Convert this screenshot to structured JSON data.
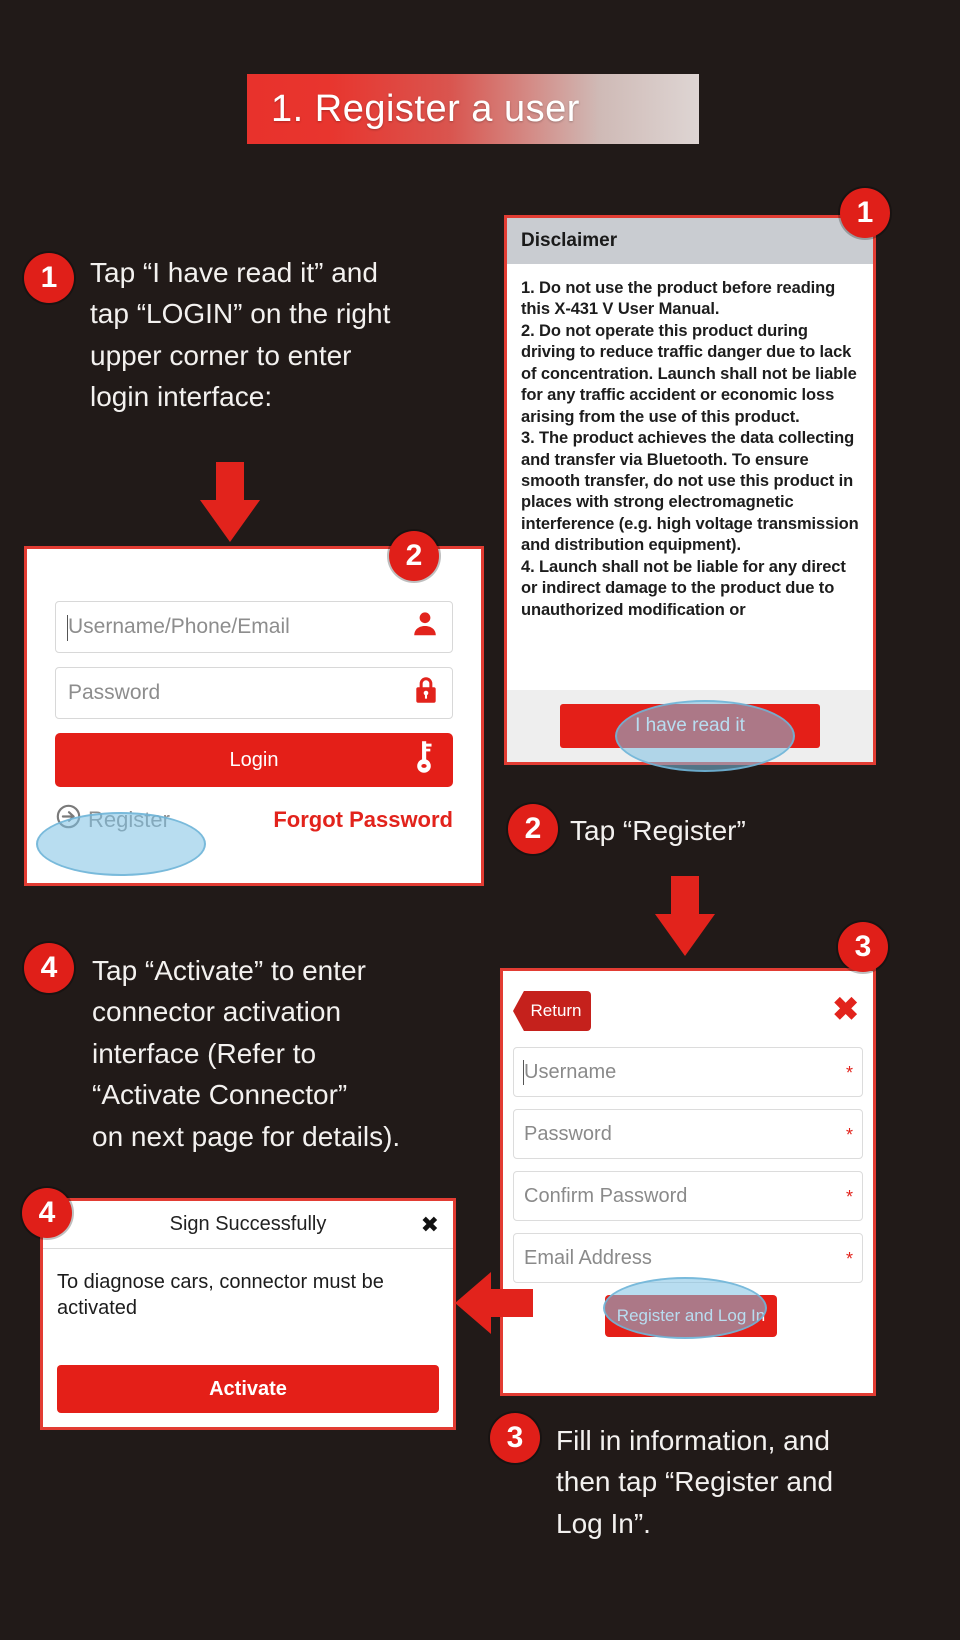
{
  "title": "1. Register a user",
  "steps": {
    "s1": {
      "num": "1",
      "text": "Tap “I have read it” and\ntap “LOGIN” on the right\nupper corner to enter\nlogin interface:"
    },
    "s2": {
      "num": "2",
      "text": "Tap “Register”"
    },
    "s3": {
      "num": "3",
      "text": "Fill in information, and\nthen tap “Register and\nLog In”."
    },
    "s4": {
      "num": "4",
      "text": "Tap “Activate” to enter\nconnector activation\ninterface (Refer to\n“Activate Connector”\non next page for details)."
    }
  },
  "markers": {
    "m1": "1",
    "m2": "2",
    "m3": "3",
    "m4": "4"
  },
  "disclaimer": {
    "title": "Disclaimer",
    "body": "1. Do not use the product before reading this X-431 V User Manual.\n 2. Do not operate this product during driving to reduce traffic danger due to lack of concentration. Launch shall not be liable for any traffic accident or economic loss arising from the use of this product.\n 3. The product achieves the data collecting and transfer via Bluetooth. To ensure smooth transfer, do not use this product in places with strong electromagnetic interference (e.g. high voltage transmission and distribution equipment).\n 4. Launch shall not be liable for any direct or indirect damage to the product due to unauthorized modification or",
    "accept_label": "I have read it"
  },
  "login": {
    "username_placeholder": "Username/Phone/Email",
    "password_placeholder": "Password",
    "login_label": "Login",
    "register_label": "Register",
    "forgot_label": "Forgot Password",
    "user_icon": "person-icon",
    "lock_icon": "lock-icon",
    "key_icon": "key-icon",
    "register_icon": "arrow-circle-right-icon"
  },
  "register": {
    "return_label": "Return",
    "close_icon": "close-x-icon",
    "fields": [
      {
        "placeholder": "Username",
        "required": "*"
      },
      {
        "placeholder": "Password",
        "required": "*"
      },
      {
        "placeholder": "Confirm Password",
        "required": "*"
      },
      {
        "placeholder": "Email Address",
        "required": "*"
      }
    ],
    "submit_label": "Register and Log In"
  },
  "sign": {
    "title": "Sign Successfully",
    "close_icon": "close-bowtie-icon",
    "message": "To diagnose cars, connector must be activated",
    "activate_label": "Activate"
  },
  "colors": {
    "background": "#211a18",
    "accent_red": "#e2231c",
    "highlight_blue": "#7ec1e3",
    "panel_border": "#e23c33"
  }
}
